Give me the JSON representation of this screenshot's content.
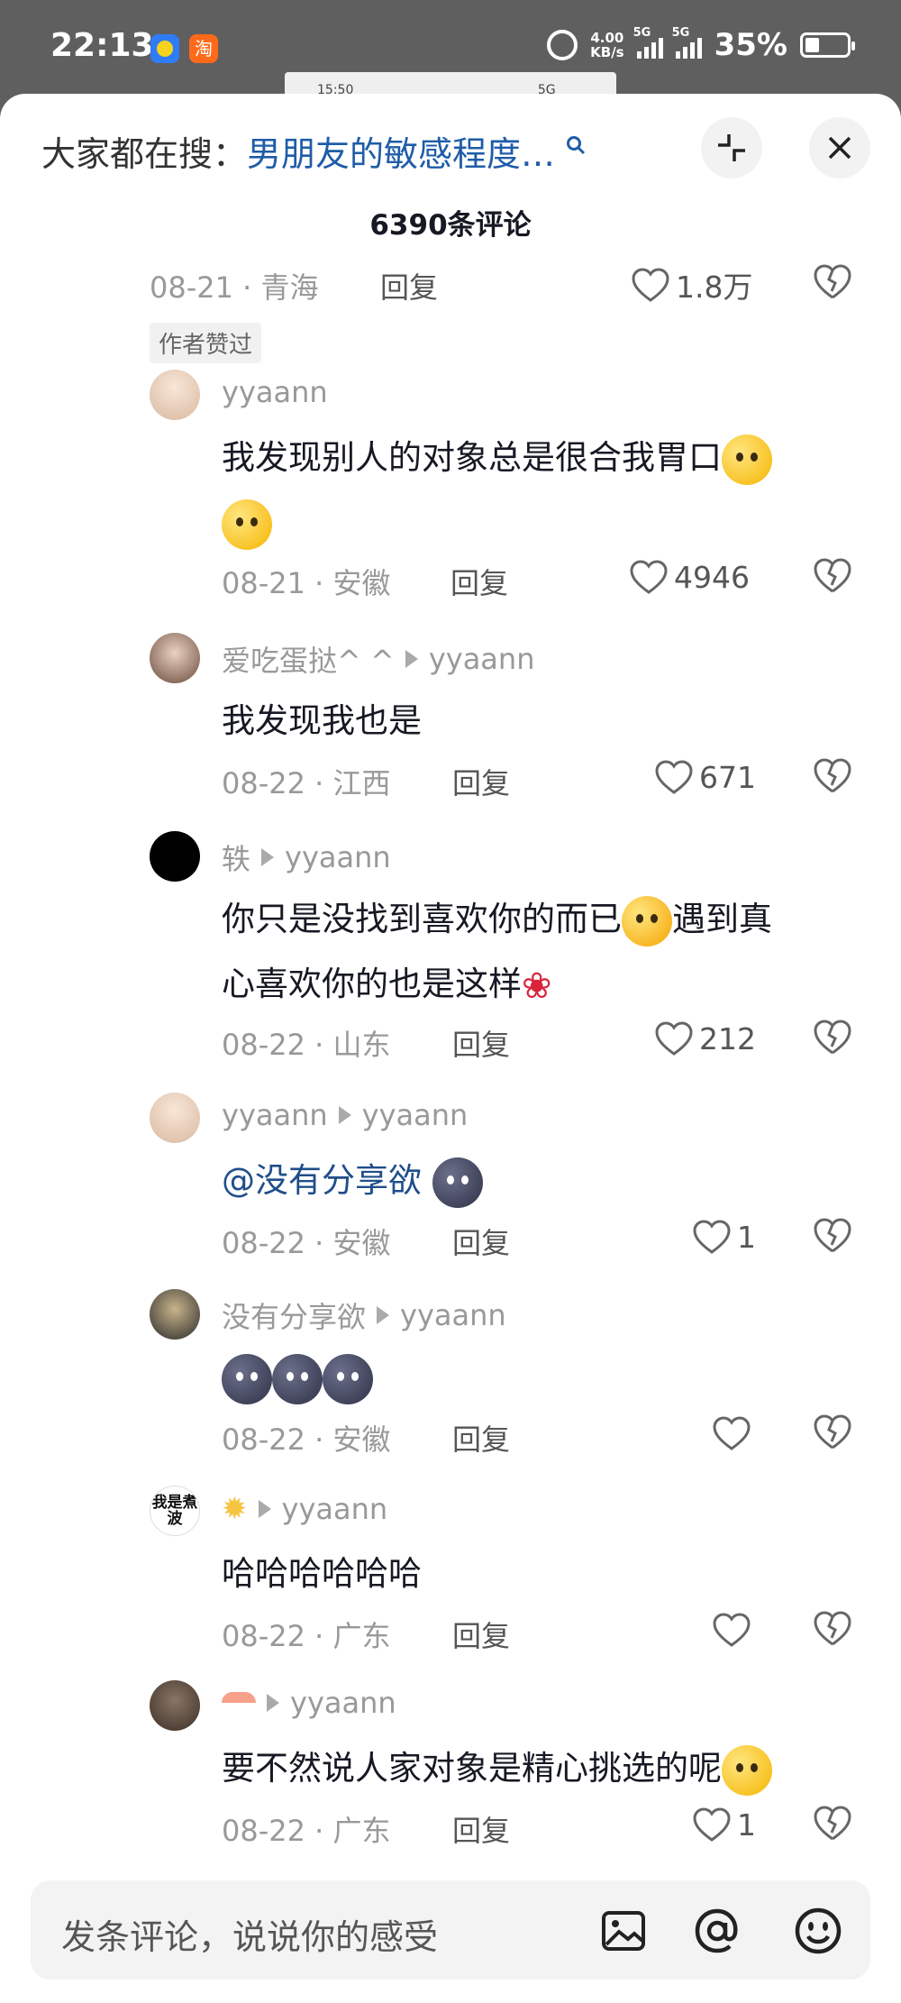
{
  "status_bar": {
    "time": "22:13",
    "app2_glyph": "淘",
    "net_speed_value": "4.00",
    "net_speed_unit": "KB/s",
    "sim1": "5G",
    "sim2": "5G",
    "battery": "35%",
    "thumb_time": "15:50",
    "thumb_net": "5G"
  },
  "header": {
    "search_prefix": "大家都在搜：",
    "search_keyword": "男朋友的敏感程度…",
    "comment_count": "6390条评论"
  },
  "top_partial": {
    "meta": "08-21 · 青海",
    "reply_label": "回复",
    "likes": "1.8万",
    "author_badge": "作者赞过"
  },
  "comments": [
    {
      "author": "yyaann",
      "reply_to": "",
      "text": "我发现别人的对象总是很合我胃口",
      "meta": "08-21 · 安徽",
      "reply_label": "回复",
      "likes": "4946"
    },
    {
      "author": "爱吃蛋挞^ ^",
      "reply_to": "yyaann",
      "text": "我发现我也是",
      "meta": "08-22 · 江西",
      "reply_label": "回复",
      "likes": "671"
    },
    {
      "author": "轶",
      "reply_to": "yyaann",
      "text_line1a": "你只是没找到喜欢你的而已",
      "text_line1b": "遇到真",
      "text_line2": "心喜欢你的也是这样",
      "meta": "08-22 · 山东",
      "reply_label": "回复",
      "likes": "212"
    },
    {
      "author": "yyaann",
      "reply_to": "yyaann",
      "text": "@没有分享欲",
      "meta": "08-22 · 安徽",
      "reply_label": "回复",
      "likes": "1"
    },
    {
      "author": "没有分享欲",
      "reply_to": "yyaann",
      "text": "",
      "meta": "08-22 · 安徽",
      "reply_label": "回复",
      "likes": ""
    },
    {
      "author": "",
      "avatar_text": "我是煮波",
      "reply_to": "yyaann",
      "text": "哈哈哈哈哈哈",
      "meta": "08-22 · 广东",
      "reply_label": "回复",
      "likes": ""
    },
    {
      "author": "",
      "reply_to": "yyaann",
      "text": "要不然说人家对象是精心挑选的呢",
      "meta": "08-22 · 广东",
      "reply_label": "回复",
      "likes": "1"
    }
  ],
  "input": {
    "placeholder": "发条评论，说说你的感受"
  },
  "icons": [
    "alarm-icon",
    "signal-icon",
    "battery-icon",
    "search-icon",
    "collapse-icon",
    "close-icon",
    "heart-icon",
    "dislike-icon",
    "image-icon",
    "at-icon",
    "emoji-icon"
  ],
  "colors": {
    "link": "#1f5ca8",
    "muted": "#999999",
    "text": "#161823",
    "status_bar": "#5f5f5f"
  }
}
